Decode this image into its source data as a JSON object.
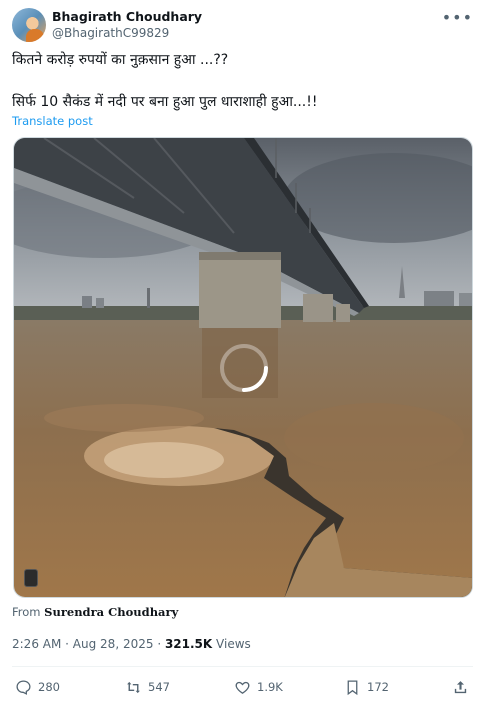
{
  "author": {
    "name": "Bhagirath Choudhary",
    "handle": "@BhagirathC99829"
  },
  "post": {
    "line1": "कितने करोड़ रुपयों का नुक़सान हुआ ...??",
    "line2": "सिर्फ 10 सैकंड में नदी पर बना हुआ पुल धाराशाही हुआ...!!",
    "translate_label": "Translate post"
  },
  "media": {
    "type": "video",
    "state": "loading"
  },
  "source": {
    "prefix": "From",
    "name": "Surendra Choudhary"
  },
  "meta": {
    "time": "2:26 AM",
    "date": "Aug 28, 2025",
    "views_count": "321.5K",
    "views_label": "Views"
  },
  "actions": {
    "replies": "280",
    "reposts": "547",
    "likes": "1.9K",
    "bookmarks": "172"
  },
  "icons": [
    "more-icon",
    "reply-icon",
    "repost-icon",
    "like-icon",
    "bookmark-icon",
    "share-icon",
    "loading-spinner-icon"
  ]
}
